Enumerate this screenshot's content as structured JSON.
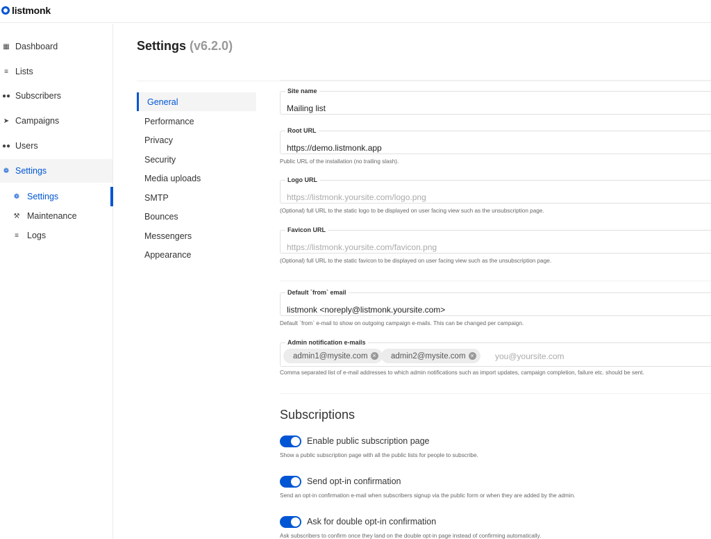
{
  "app": {
    "name": "listmonk"
  },
  "sidebar": {
    "items": [
      {
        "label": "Dashboard",
        "icon": "dashboard-icon"
      },
      {
        "label": "Lists",
        "icon": "list-icon"
      },
      {
        "label": "Subscribers",
        "icon": "users-icon"
      },
      {
        "label": "Campaigns",
        "icon": "rocket-icon"
      },
      {
        "label": "Users",
        "icon": "users-icon"
      },
      {
        "label": "Settings",
        "icon": "gear-icon"
      }
    ],
    "subitems": [
      {
        "label": "Settings",
        "icon": "gear-icon"
      },
      {
        "label": "Maintenance",
        "icon": "wrench-icon"
      },
      {
        "label": "Logs",
        "icon": "list-icon"
      }
    ]
  },
  "header": {
    "title": "Settings",
    "version": "(v6.2.0)"
  },
  "tabs": [
    "General",
    "Performance",
    "Privacy",
    "Security",
    "Media uploads",
    "SMTP",
    "Bounces",
    "Messengers",
    "Appearance"
  ],
  "form": {
    "site_name": {
      "label": "Site name",
      "value": "Mailing list"
    },
    "root_url": {
      "label": "Root URL",
      "value": "https://demo.listmonk.app",
      "help": "Public URL of the installation (no trailing slash)."
    },
    "logo_url": {
      "label": "Logo URL",
      "placeholder": "https://listmonk.yoursite.com/logo.png",
      "help": "(Optional) full URL to the static logo to be displayed on user facing view such as the unsubscription page."
    },
    "favicon_url": {
      "label": "Favicon URL",
      "placeholder": "https://listmonk.yoursite.com/favicon.png",
      "help": "(Optional) full URL to the static favicon to be displayed on user facing view such as the unsubscription page."
    },
    "from_email": {
      "label": "Default `from` email",
      "value": "listmonk <noreply@listmonk.yoursite.com>",
      "help": "Default `from` e-mail to show on outgoing campaign e-mails. This can be changed per campaign."
    },
    "admin_emails": {
      "label": "Admin notification e-mails",
      "tags": [
        "admin1@mysite.com",
        "admin2@mysite.com"
      ],
      "placeholder": "you@yoursite.com",
      "help": "Comma separated list of e-mail addresses to which admin notifications such as import updates, campaign completion, failure etc. should be sent."
    }
  },
  "subscriptions": {
    "title": "Subscriptions",
    "toggles": [
      {
        "label": "Enable public subscription page",
        "help": "Show a public subscription page with all the public lists for people to subscribe.",
        "on": true
      },
      {
        "label": "Send opt-in confirmation",
        "help": "Send an opt-in confirmation e-mail when subscribers signup via the public form or when they are added by the admin.",
        "on": true
      },
      {
        "label": "Ask for double opt-in confirmation",
        "help": "Ask subscribers to confirm once they land on the double opt-in page instead of confirming automatically.",
        "on": true
      }
    ]
  },
  "colors": {
    "accent": "#0055d4",
    "help_text": "#666666"
  }
}
